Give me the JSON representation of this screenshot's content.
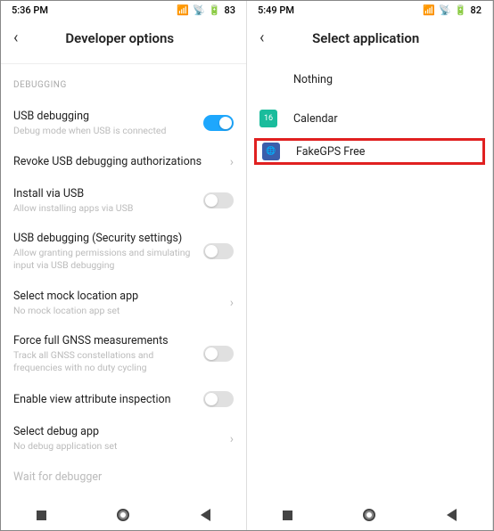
{
  "left": {
    "time": "5:36 PM",
    "battery": "83",
    "title": "Developer options",
    "section": "DEBUGGING",
    "rows": [
      {
        "title": "USB debugging",
        "sub": "Debug mode when USB is connected",
        "toggle": true,
        "on": true
      },
      {
        "title": "Revoke USB debugging authorizations",
        "chevron": true
      },
      {
        "title": "Install via USB",
        "sub": "Allow installing apps via USB",
        "toggle": true,
        "on": false
      },
      {
        "title": "USB debugging (Security settings)",
        "sub": "Allow granting permissions and simulating input via USB debugging",
        "toggle": true,
        "on": false
      },
      {
        "title": "Select mock location app",
        "sub": "No mock location app set",
        "chevron": true
      },
      {
        "title": "Force full GNSS measurements",
        "sub": "Track all GNSS constellations and frequencies with no duty cycling",
        "toggle": true,
        "on": false
      },
      {
        "title": "Enable view attribute inspection",
        "toggle": true,
        "on": false
      },
      {
        "title": "Select debug app",
        "sub": "No debug application set",
        "chevron": true
      },
      {
        "title": "Wait for debugger",
        "faded": true
      }
    ]
  },
  "right": {
    "time": "5:49 PM",
    "battery": "82",
    "title": "Select application",
    "apps": [
      {
        "name": "Nothing",
        "icon": "none"
      },
      {
        "name": "Calendar",
        "icon": "calendar"
      },
      {
        "name": "FakeGPS Free",
        "icon": "fakegps",
        "highlight": true
      }
    ]
  }
}
